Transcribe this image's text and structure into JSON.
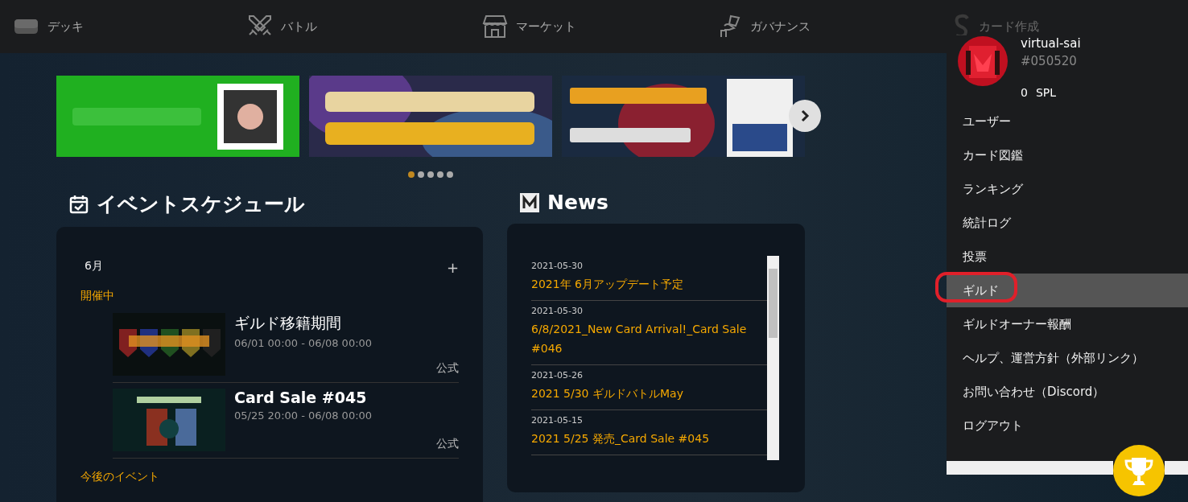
{
  "nav": [
    {
      "label": "デッキ",
      "kind": "deck",
      "disabled": false
    },
    {
      "label": "バトル",
      "kind": "battle",
      "disabled": false
    },
    {
      "label": "マーケット",
      "kind": "market",
      "disabled": false
    },
    {
      "label": "ガバナンス",
      "kind": "governance",
      "disabled": false
    },
    {
      "label": "カード作成",
      "kind": "creation",
      "disabled": true
    }
  ],
  "carousel": {
    "dots": [
      {
        "selected": true
      },
      {
        "selected": false
      },
      {
        "selected": false
      },
      {
        "selected": false
      },
      {
        "selected": false
      }
    ]
  },
  "events": {
    "title": "イベントスケジュール",
    "month": "6月",
    "add": "+",
    "groups": [
      {
        "label": "開催中",
        "items": [
          {
            "title": "ギルド移籍期間",
            "time": "06/01 00:00 - 06/08 00:00",
            "tag": "公式"
          },
          {
            "title": "Card Sale #045",
            "time": "05/25 20:00 - 06/08 00:00",
            "tag": "公式"
          }
        ]
      },
      {
        "label": "今後のイベント"
      }
    ]
  },
  "news": {
    "title": "News",
    "items": [
      {
        "date": "2021-05-30",
        "title": "2021年 6月アップデート予定"
      },
      {
        "date": "2021-05-30",
        "title": "6/8/2021_New Card Arrival!_Card Sale #046"
      },
      {
        "date": "2021-05-26",
        "title": "2021 5/30 ギルドバトルMay"
      },
      {
        "date": "2021-05-15",
        "title": "2021 5/25 発売_Card Sale #045"
      }
    ]
  },
  "user_menu": {
    "username": "virtual-sai",
    "user_id": "#050520",
    "balance": "0",
    "currency": "SPL",
    "items": [
      {
        "label": "ユーザー",
        "selected": false,
        "circled": false
      },
      {
        "label": "カード図鑑",
        "selected": false,
        "circled": false
      },
      {
        "label": "ランキング",
        "selected": false,
        "circled": false
      },
      {
        "label": "統計ログ",
        "selected": false,
        "circled": false
      },
      {
        "label": "投票",
        "selected": false,
        "circled": false
      },
      {
        "label": "ギルド",
        "selected": true,
        "circled": true
      },
      {
        "label": "ギルドオーナー報酬",
        "selected": false,
        "circled": false
      },
      {
        "label": "ヘルプ、運営方針（外部リンク）",
        "selected": false,
        "circled": false
      },
      {
        "label": "お問い合わせ（Discord）",
        "selected": false,
        "circled": false
      },
      {
        "label": "ログアウト",
        "selected": false,
        "circled": false
      }
    ]
  }
}
